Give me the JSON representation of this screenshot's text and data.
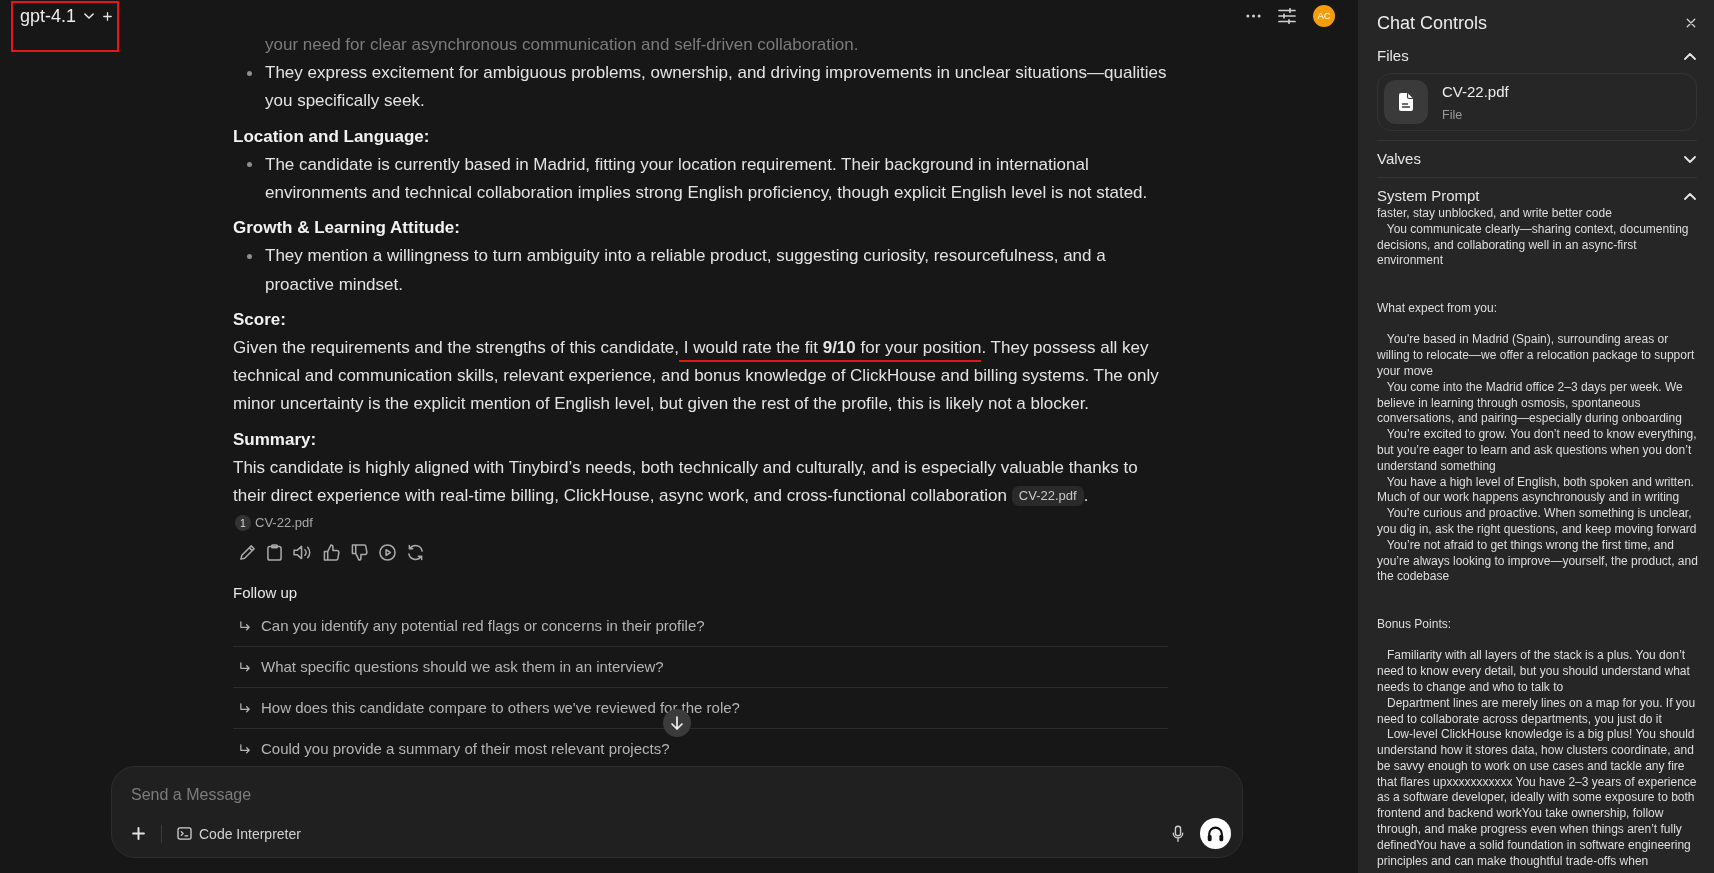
{
  "top_bar": {
    "model": {
      "name": "gpt-4.1",
      "annotated": true
    },
    "avatar_initials": "AC"
  },
  "message": {
    "blocks": [
      {
        "kind": "fragment",
        "text": "your need for clear asynchronous communication and self-driven collaboration."
      },
      {
        "kind": "bullet",
        "text": "They express excitement for ambiguous problems, ownership, and driving improvements in unclear situations—qualities you specifically seek."
      },
      {
        "kind": "heading",
        "text": "Location and Language:"
      },
      {
        "kind": "bullet",
        "text": "The candidate is currently based in Madrid, fitting your location requirement. Their background in international environments and technical collaboration implies strong English proficiency, though explicit English level is not stated."
      },
      {
        "kind": "heading",
        "text": "Growth & Learning Attitude:"
      },
      {
        "kind": "bullet",
        "text": "They mention a willingness to turn ambiguity into a reliable product, suggesting curiosity, resourcefulness, and a proactive mindset."
      },
      {
        "kind": "heading",
        "text": "Score:"
      },
      {
        "kind": "paragraph",
        "segments": [
          {
            "kind": "text",
            "text": "Given the requirements and the strengths of this candidate,",
            "underlined": false
          },
          {
            "kind": "text",
            "text": " I would rate the fit **9/10** for your position",
            "underlined": true
          },
          {
            "kind": "text",
            "text": ". They possess all key technical and communication skills, relevant experience, and bonus knowledge of ClickHouse and billing systems. The only minor uncertainty is the explicit mention of English level, but given the rest of the profile, this is likely not a blocker.",
            "underlined": false
          }
        ]
      },
      {
        "kind": "heading",
        "text": "Summary:"
      },
      {
        "kind": "paragraph",
        "segments": [
          {
            "kind": "text",
            "text": "This candidate is highly aligned with Tinybird’s needs, both technically and culturally, and is especially valuable thanks to their direct experience with real-time billing, ClickHouse, async work, and cross-functional collaboration",
            "underlined": false
          },
          {
            "kind": "citation",
            "text": "CV-22.pdf",
            "underlined": false
          },
          {
            "kind": "text",
            "text": ".",
            "underlined": false
          }
        ]
      }
    ],
    "sources": [
      {
        "number": "1",
        "name": "CV-22.pdf"
      }
    ]
  },
  "follow_up": {
    "title": "Follow up",
    "items": [
      "Can you identify any potential red flags or concerns in their profile?",
      "What specific questions should we ask them in an interview?",
      "How does this candidate compare to others we've reviewed for the role?",
      "Could you provide a summary of their most relevant projects?"
    ]
  },
  "composer": {
    "placeholder": "Send a Message",
    "tool": "Code Interpreter"
  },
  "chat_controls": {
    "title": "Chat Controls",
    "sections": [
      {
        "kind": "files",
        "title": "Files",
        "expanded": true,
        "files": [
          {
            "name": "CV-22.pdf",
            "type": "File"
          }
        ]
      },
      {
        "kind": "valves",
        "title": "Valves",
        "expanded": false
      },
      {
        "kind": "prompt",
        "title": "System Prompt",
        "expanded": true,
        "value": "faster, stay unblocked, and write better code\n   You communicate clearly—sharing context, documenting\ndecisions, and collaborating well in an async-first\nenvironment\n\n\nWhat expect from you:\n\n   You're based in Madrid (Spain), surrounding areas or\nwilling to relocate—we offer a relocation package to support\nyour move\n   You come into the Madrid office 2–3 days per week. We\nbelieve in learning through osmosis, spontaneous\nconversations, and pairing—especially during onboarding\n   You’re excited to grow. You don’t need to know everything,\nbut you’re eager to learn and ask questions when you don’t\nunderstand something\n   You have a high level of English, both spoken and written.\nMuch of our work happens asynchronously and in writing\n   You're curious and proactive. When something is unclear,\nyou dig in, ask the right questions, and keep moving forward\n   You’re not afraid to get things wrong the first time, and\nyou’re always looking to improve—yourself, the product, and\nthe codebase\n\n\nBonus Points:\n\n   Familiarity with all layers of the stack is a plus. You don’t\nneed to know every detail, but you should understand what\nneeds to change and who to talk to\n   Department lines are merely lines on a map for you. If you\nneed to collaborate across departments, you just do it\n   Low-level ClickHouse knowledge is a big plus! You should\nunderstand how it stores data, how clusters coordinate, and\nbe savvy enough to work on use cases and tackle any fire\nthat flares upxxxxxxxxxxx You have 2–3 years of experience\nas a software developer, ideally with some exposure to both\nfrontend and backend workYou take ownership, follow\nthrough, and make progress even when things aren’t fully\ndefinedYou have a solid foundation in software engineering\nprinciples and can make thoughtful trade-offs when"
      }
    ]
  }
}
